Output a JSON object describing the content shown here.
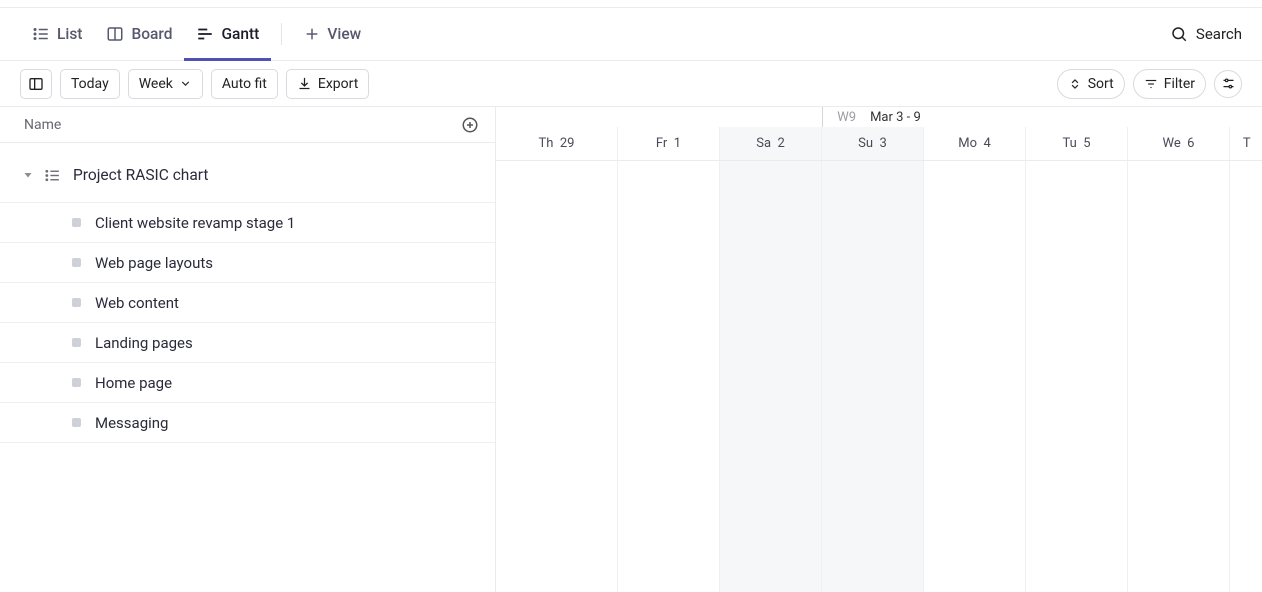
{
  "tabs": {
    "list": "List",
    "board": "Board",
    "gantt": "Gantt",
    "addView": "View"
  },
  "search": {
    "label": "Search"
  },
  "toolbar": {
    "today": "Today",
    "range": "Week",
    "autofit": "Auto fit",
    "export": "Export",
    "sort": "Sort",
    "filter": "Filter"
  },
  "leftHeader": {
    "name": "Name"
  },
  "group": {
    "title": "Project RASIC chart"
  },
  "tasks": [
    "Client website revamp stage 1",
    "Web page layouts",
    "Web content",
    "Landing pages",
    "Home page",
    "Messaging"
  ],
  "timeline": {
    "weekLabel": "W9",
    "rangeLabel": "Mar 3 - 9",
    "days": [
      {
        "dow": "Th",
        "num": "29"
      },
      {
        "dow": "Fr",
        "num": "1"
      },
      {
        "dow": "Sa",
        "num": "2"
      },
      {
        "dow": "Su",
        "num": "3"
      },
      {
        "dow": "Mo",
        "num": "4"
      },
      {
        "dow": "Tu",
        "num": "5"
      },
      {
        "dow": "We",
        "num": "6"
      },
      {
        "dow": "T",
        "num": ""
      }
    ]
  }
}
